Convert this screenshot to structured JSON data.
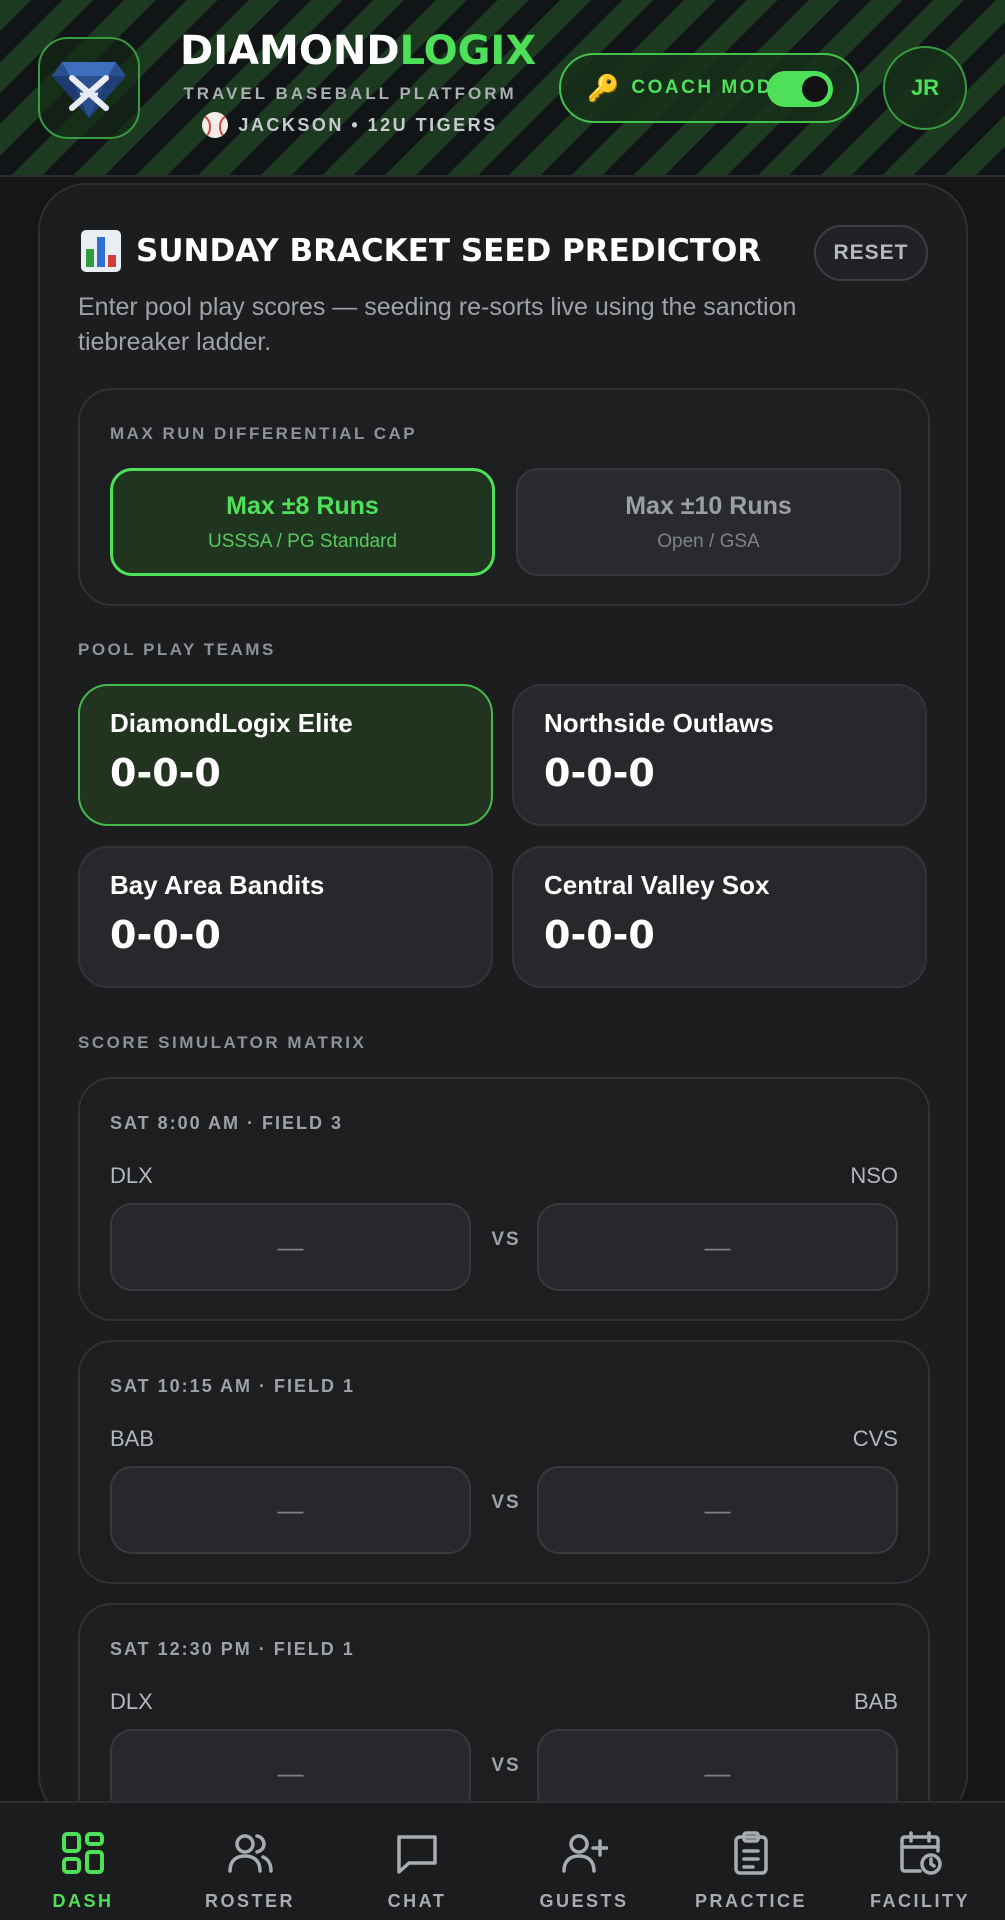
{
  "header": {
    "brand_part1": "DIAMOND",
    "brand_part2": "LOGIX",
    "subtitle": "TRAVEL BASEBALL PLATFORM",
    "team_line": "JACKSON • 12U TIGERS",
    "coach_mode_label": "COACH MODE",
    "coach_mode_on": true,
    "avatar_initials": "JR"
  },
  "panel": {
    "title": "SUNDAY BRACKET SEED PREDICTOR",
    "reset_label": "RESET",
    "description": "Enter pool play scores — seeding re-sorts live using the sanction tiebreaker ladder."
  },
  "cap": {
    "label": "MAX RUN DIFFERENTIAL CAP",
    "options": [
      {
        "main": "Max ±8 Runs",
        "sub": "USSSA / PG Standard",
        "selected": true
      },
      {
        "main": "Max ±10 Runs",
        "sub": "Open / GSA",
        "selected": false
      }
    ]
  },
  "pool": {
    "label": "POOL PLAY TEAMS",
    "teams": [
      {
        "name": "DiamondLogix Elite",
        "record": "0-0-0",
        "highlighted": true
      },
      {
        "name": "Northside Outlaws",
        "record": "0-0-0"
      },
      {
        "name": "Bay Area Bandits",
        "record": "0-0-0"
      },
      {
        "name": "Central Valley Sox",
        "record": "0-0-0"
      }
    ]
  },
  "matrix": {
    "label": "SCORE SIMULATOR MATRIX",
    "vs_label": "VS",
    "games": [
      {
        "time": "SAT 8:00 AM · FIELD 3",
        "home": "DLX",
        "away": "NSO",
        "home_score": "—",
        "away_score": "—"
      },
      {
        "time": "SAT 10:15 AM · FIELD 1",
        "home": "BAB",
        "away": "CVS",
        "home_score": "—",
        "away_score": "—"
      },
      {
        "time": "SAT 12:30 PM · FIELD 1",
        "home": "DLX",
        "away": "BAB",
        "home_score": "—",
        "away_score": "—"
      }
    ]
  },
  "nav": {
    "items": [
      {
        "label": "DASH",
        "icon": "grid-icon",
        "active": true
      },
      {
        "label": "ROSTER",
        "icon": "users-icon"
      },
      {
        "label": "CHAT",
        "icon": "chat-icon"
      },
      {
        "label": "GUESTS",
        "icon": "user-plus-icon"
      },
      {
        "label": "PRACTICE",
        "icon": "clipboard-icon"
      },
      {
        "label": "FACILITY",
        "icon": "calendar-clock-icon"
      }
    ]
  },
  "colors": {
    "accent": "#4fe05a",
    "background": "#151617",
    "card": "#27282b"
  }
}
